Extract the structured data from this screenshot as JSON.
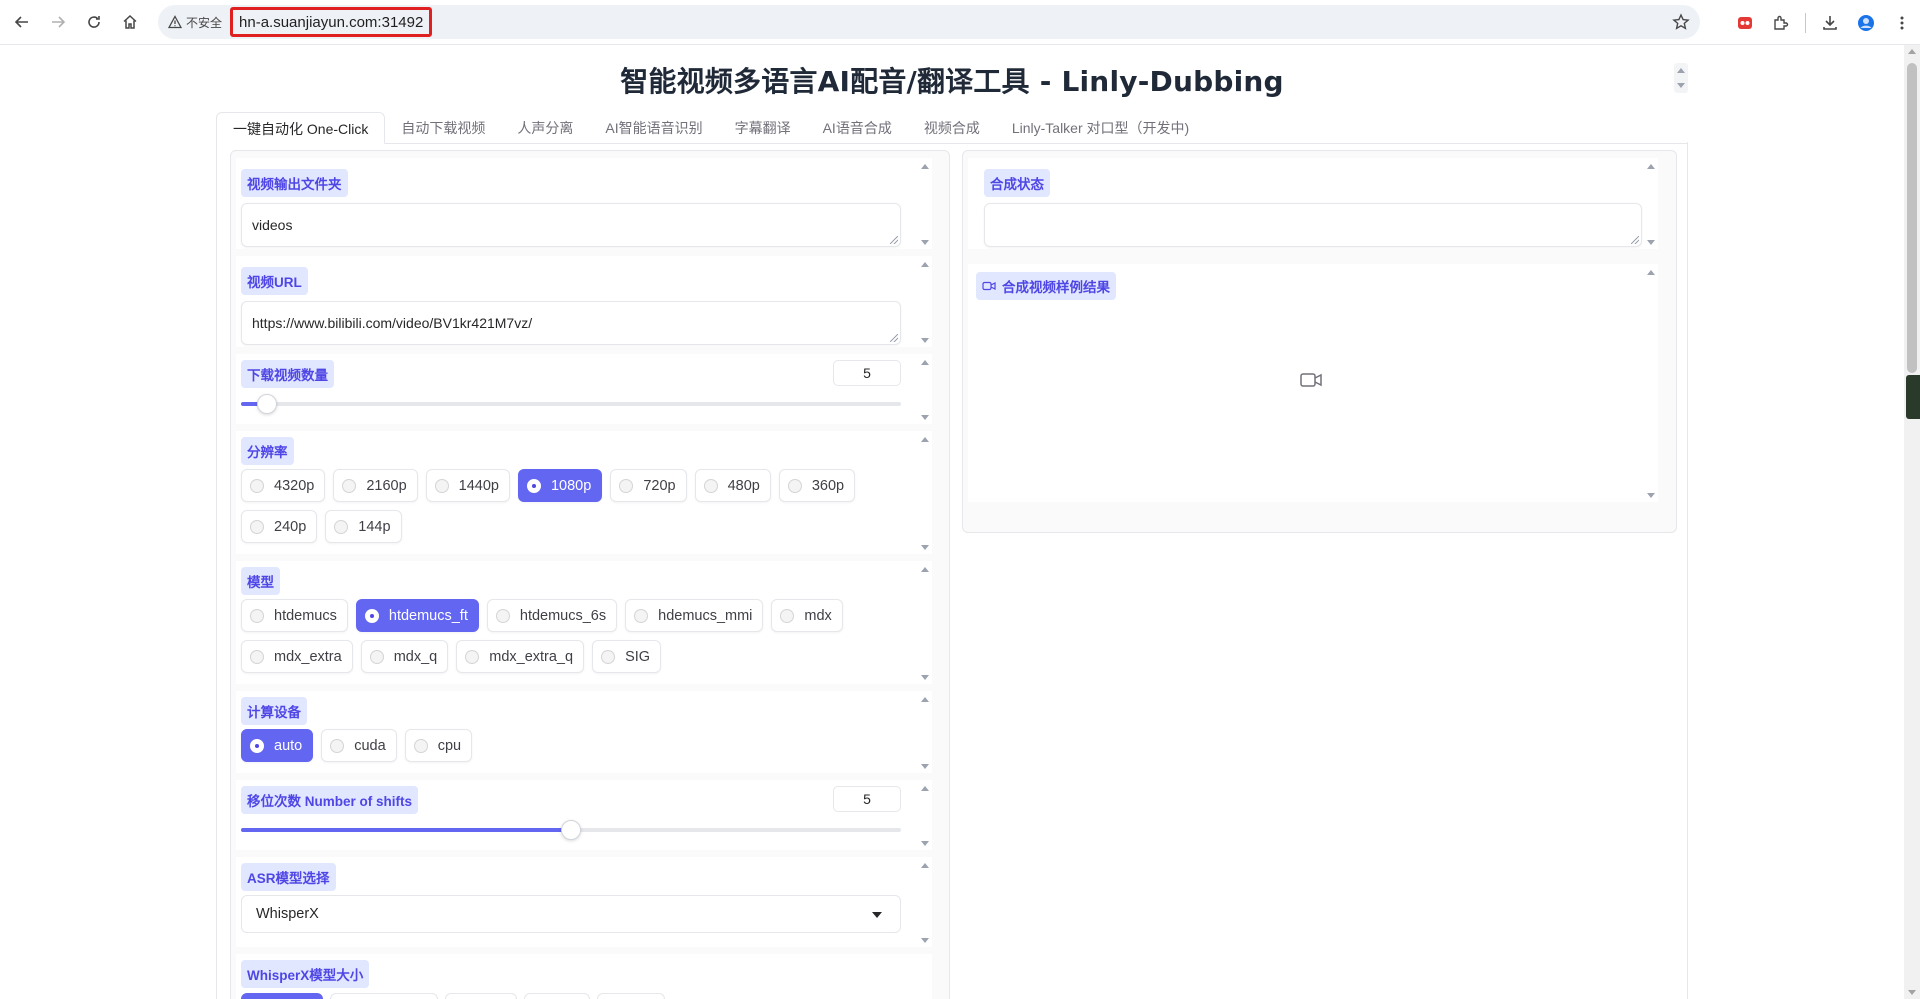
{
  "browser": {
    "security_label": "不安全",
    "url": "hn-a.suanjiayun.com:31492"
  },
  "app": {
    "title": "智能视频多语言AI配音/翻译工具 - Linly-Dubbing"
  },
  "tabs": [
    {
      "label": "一键自动化 One-Click",
      "active": true
    },
    {
      "label": "自动下载视频",
      "active": false
    },
    {
      "label": "人声分离",
      "active": false
    },
    {
      "label": "AI智能语音识别",
      "active": false
    },
    {
      "label": "字幕翻译",
      "active": false
    },
    {
      "label": "AI语音合成",
      "active": false
    },
    {
      "label": "视频合成",
      "active": false
    },
    {
      "label": "Linly-Talker 对口型（开发中)",
      "active": false
    }
  ],
  "form": {
    "output_folder": {
      "label": "视频输出文件夹",
      "value": "videos"
    },
    "video_url": {
      "label": "视频URL",
      "value": "https://www.bilibili.com/video/BV1kr421M7vz/"
    },
    "download_count": {
      "label": "下载视频数量",
      "value": "5",
      "fraction": 0.04
    },
    "resolution": {
      "label": "分辨率",
      "options": [
        "4320p",
        "2160p",
        "1440p",
        "1080p",
        "720p",
        "480p",
        "360p",
        "240p",
        "144p"
      ],
      "selected": "1080p"
    },
    "model": {
      "label": "模型",
      "options": [
        "htdemucs",
        "htdemucs_ft",
        "htdemucs_6s",
        "hdemucs_mmi",
        "mdx",
        "mdx_extra",
        "mdx_q",
        "mdx_extra_q",
        "SIG"
      ],
      "selected": "htdemucs_ft"
    },
    "device": {
      "label": "计算设备",
      "options": [
        "auto",
        "cuda",
        "cpu"
      ],
      "selected": "auto"
    },
    "shifts": {
      "label": "移位次数 Number of shifts",
      "value": "5",
      "fraction": 0.5
    },
    "asr_model": {
      "label": "ASR模型选择",
      "value": "WhisperX"
    },
    "whisperx_size": {
      "label": "WhisperX模型大小"
    }
  },
  "output": {
    "status_label": "合成状态",
    "status_value": "",
    "video_label": "合成视频样例结果"
  },
  "colors": {
    "accent": "#6366f1",
    "label_bg": "#e0e7ff",
    "label_text": "#4f46e5",
    "url_highlight": "#e02020"
  }
}
